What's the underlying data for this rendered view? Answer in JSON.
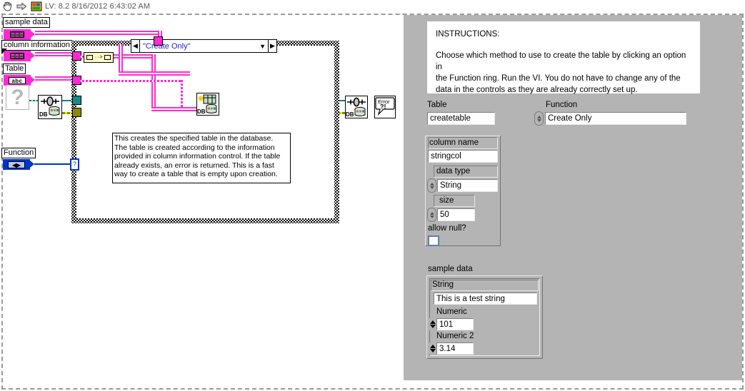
{
  "window": {
    "title": "LV: 8.2 8/16/2012 6:43:02 AM",
    "icons": [
      "hand-cursor-icon",
      "run-arrow-icon",
      "labview-icon"
    ]
  },
  "block_diagram": {
    "terminals": [
      {
        "label": "sample data",
        "type": "cluster",
        "name": "terminal-sample-data"
      },
      {
        "label": "column information",
        "type": "cluster",
        "name": "terminal-column-information"
      },
      {
        "label": "Table",
        "type": "string",
        "glyph": "abc",
        "name": "terminal-table"
      },
      {
        "label": "Function",
        "type": "enum",
        "glyph": "◀▶",
        "name": "terminal-function"
      }
    ],
    "unknown_glyph": "?",
    "case_structure": {
      "selector_value": "\"Create Only\"",
      "nav_left": "◀",
      "nav_right": "▶",
      "caret": "▼",
      "selector_terminal": "?"
    },
    "nodes": [
      {
        "name": "db-open-connection-node",
        "label": "DB"
      },
      {
        "name": "db-create-table-node",
        "label": "DB"
      },
      {
        "name": "db-close-connection-node",
        "label": "DB"
      },
      {
        "name": "simple-error-handler-node",
        "label": "Error",
        "sub": "?!"
      },
      {
        "name": "array-to-cluster-node",
        "label": ""
      }
    ],
    "comment": "This creates the specified table in the database. The table is created according to the information provided in column information control.  If the table already exists, an error is returned.  This is a fast way to create a table that is empty upon creation.",
    "comment_lines": [
      "This creates the specified table in the database.",
      "The table is created according to the information",
      "provided in column information control.  If the table",
      "already exists, an error is returned.  This is a fast",
      "way to create a table that is empty upon creation."
    ]
  },
  "front_panel": {
    "instructions": {
      "heading": "INSTRUCTIONS:",
      "body_lines": [
        "Choose which method to use to create the table by clicking an option in",
        "the Function ring.  Run the VI.  You do not have to change any of the",
        "data in the controls as they are already correctly set up."
      ]
    },
    "table_control": {
      "label": "Table",
      "value": "createtable"
    },
    "function_control": {
      "label": "Function",
      "value": "Create Only"
    },
    "column_information": {
      "column_name": {
        "label": "column name",
        "value": "stringcol"
      },
      "data_type": {
        "label": "data type",
        "value": "String"
      },
      "size": {
        "label": "size",
        "value": "50"
      },
      "allow_null": {
        "label": "allow null?",
        "checked": false
      }
    },
    "sample_data": {
      "label": "sample data",
      "string": {
        "label": "String",
        "value": "This is a test string"
      },
      "numeric": {
        "label": "Numeric",
        "value": "101"
      },
      "numeric_2": {
        "label": "Numeric 2",
        "value": "3.14"
      }
    }
  },
  "colors": {
    "wire_cluster": "#ff2ad4",
    "wire_error": "#8a8a00",
    "wire_refnum": "#108080",
    "wire_enum": "#0034c8",
    "panel_bg": "#b4b4b4",
    "selector_text": "#2222cc"
  }
}
